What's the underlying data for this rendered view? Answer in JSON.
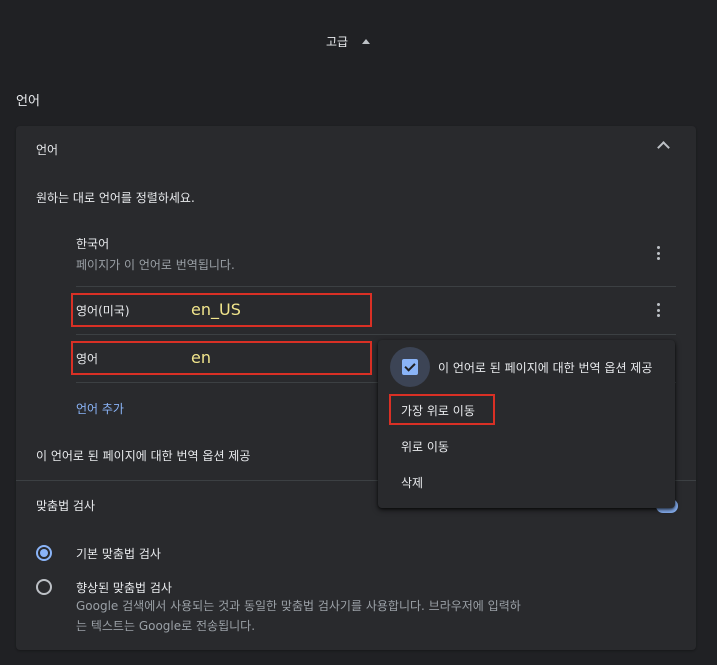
{
  "advanced": {
    "label": "고급"
  },
  "section": {
    "title": "언어"
  },
  "card": {
    "header": "언어",
    "description": "원하는 대로 언어를 정렬하세요."
  },
  "languages": [
    {
      "name": "한국어",
      "subtitle": "페이지가 이 언어로 번역됩니다."
    },
    {
      "name": "영어(미국)",
      "code": "en_US"
    },
    {
      "name": "영어",
      "code": "en"
    }
  ],
  "add_language": "언어 추가",
  "offer_translate": "이 언어로 된 페이지에 대한 번역 옵션 제공",
  "spellcheck": {
    "title": "맞춤법 검사",
    "options": [
      {
        "label": "기본 맞춤법 검사",
        "selected": true
      },
      {
        "label": "향상된 맞춤법 검사",
        "selected": false,
        "description_line1": "Google 검색에서 사용되는 것과 동일한 맞춤법 검사기를 사용합니다. 브라우저에 입력하",
        "description_line2": "는 텍스트는 Google로 전송됩니다."
      }
    ]
  },
  "menu": {
    "offer_translate": "이 언어로 된 페이지에 대한 번역 옵션 제공",
    "offer_checked": true,
    "items": [
      "가장 위로 이동",
      "위로 이동",
      "삭제"
    ]
  },
  "colors": {
    "background": "#202124",
    "card": "#292a2d",
    "accent": "#8ab4f8",
    "highlight": "#d93025",
    "code_text": "#f1e58c"
  }
}
